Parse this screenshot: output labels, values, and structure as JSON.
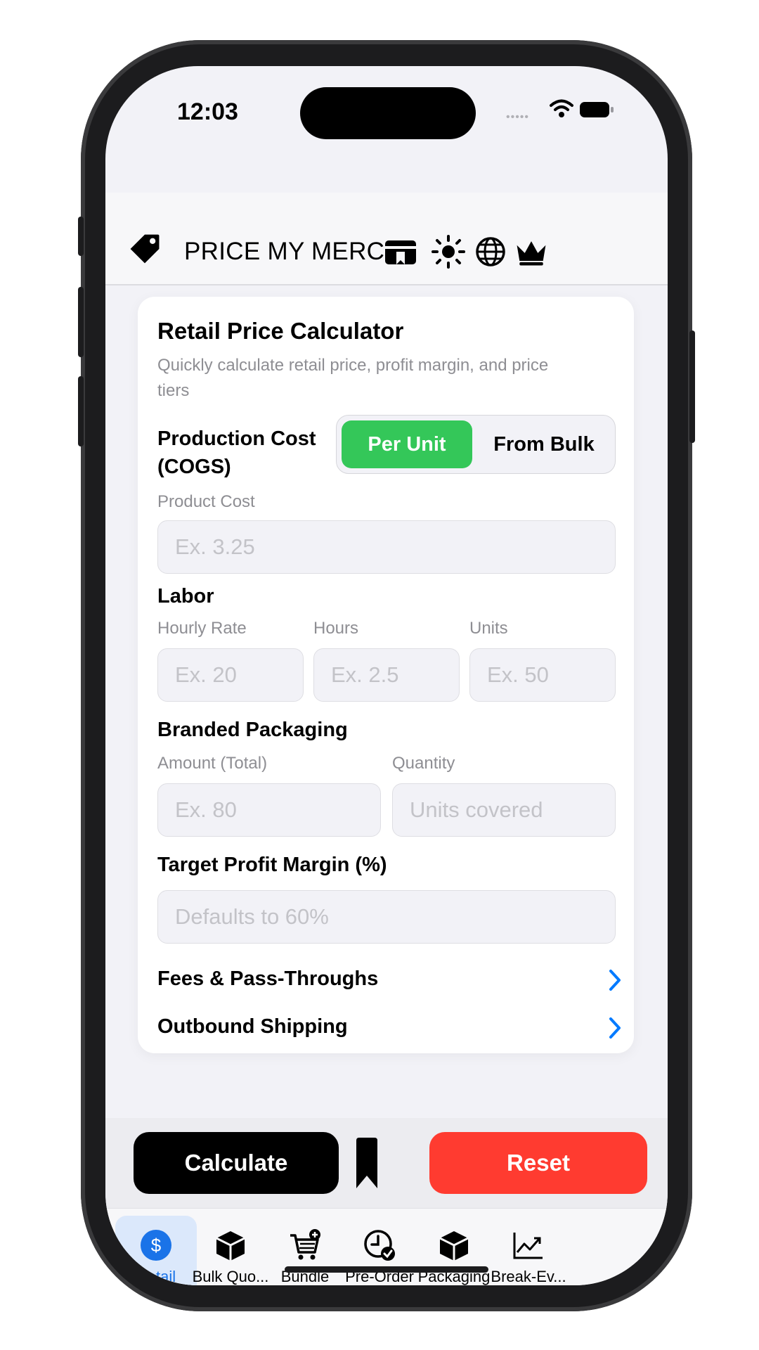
{
  "status": {
    "time": "12:03",
    "signal_dots": "•••••"
  },
  "navbar": {
    "title": "PRICE MY MERCH"
  },
  "card": {
    "title": "Retail Price Calculator",
    "subtitle": "Quickly calculate retail price, profit margin, and price tiers",
    "production": {
      "heading": "Production Cost (COGS)",
      "segments": [
        "Per Unit",
        "From Bulk"
      ],
      "selected": "Per Unit",
      "product_cost_label": "Product Cost",
      "product_cost_placeholder": "Ex. 3.25"
    },
    "labor": {
      "heading": "Labor",
      "hourly_rate_label": "Hourly Rate",
      "hourly_rate_placeholder": "Ex. 20",
      "hours_label": "Hours",
      "hours_placeholder": "Ex. 2.5",
      "units_label": "Units",
      "units_placeholder": "Ex. 50"
    },
    "packaging": {
      "heading": "Branded Packaging",
      "amount_label": "Amount (Total)",
      "amount_placeholder": "Ex. 80",
      "quantity_label": "Quantity",
      "quantity_placeholder": "Units covered"
    },
    "margin": {
      "heading": "Target Profit Margin (%)",
      "placeholder": "Defaults to 60%"
    },
    "links": [
      "Fees & Pass-Throughs",
      "Outbound Shipping"
    ]
  },
  "actions": {
    "calculate": "Calculate",
    "reset": "Reset"
  },
  "tabs": [
    {
      "label": "Retail",
      "icon": "dollar-circle-icon"
    },
    {
      "label": "Bulk Quo...",
      "icon": "box-icon"
    },
    {
      "label": "Bundle",
      "icon": "cart-plus-icon"
    },
    {
      "label": "Pre-Order",
      "icon": "clock-check-icon"
    },
    {
      "label": "Packaging",
      "icon": "box-icon"
    },
    {
      "label": "Break-Ev...",
      "icon": "chart-line-icon"
    }
  ],
  "colors": {
    "accent_green": "#34c759",
    "reset_red": "#ff3b30",
    "tab_active_blue": "#1a73e8"
  }
}
